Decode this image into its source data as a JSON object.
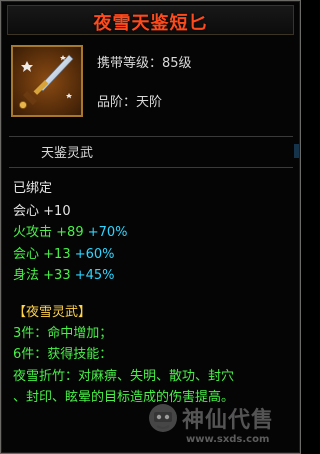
{
  "item": {
    "name": "夜雪天鉴短匕",
    "icon": "dagger-icon",
    "level_label": "携带等级：",
    "level_value": "85级",
    "grade_label": "品阶：",
    "grade_value": "天阶",
    "subtitle": "天鉴灵武"
  },
  "status": "已绑定",
  "base_stats": [
    {
      "label": "会心",
      "value": "+10"
    }
  ],
  "bonus_stats": [
    {
      "label": "火攻击",
      "value": "+89",
      "bonus": "+70%"
    },
    {
      "label": "会心",
      "value": "+13",
      "bonus": "+60%"
    },
    {
      "label": "身法",
      "value": "+33",
      "bonus": "+45%"
    }
  ],
  "set": {
    "title": "【夜雪灵武】",
    "lines": [
      "3件：命中增加；",
      "6件：获得技能：",
      "夜雪折竹：对麻痹、失明、散功、封穴",
      "、封印、眩晕的目标造成的伤害提高。"
    ]
  },
  "watermark": {
    "name": "神仙代售",
    "url": "www.sxds.com"
  },
  "colors": {
    "title": "#ff4a1c",
    "green": "#48f048",
    "cyan": "#2fd6ff",
    "gold": "#ffd24a",
    "white": "#e6e6e6",
    "frame": "#a6792c"
  }
}
